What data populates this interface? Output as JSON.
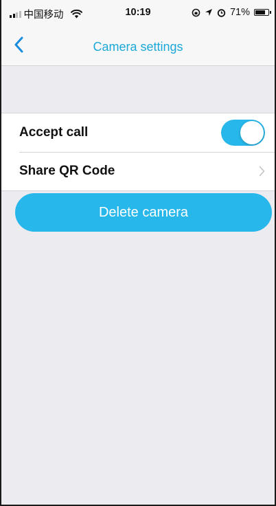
{
  "status_bar": {
    "carrier": "中国移动",
    "time": "10:19",
    "battery": "71%",
    "battery_level": 0.71
  },
  "nav": {
    "title": "Camera settings",
    "back_icon": "chevron-left-icon"
  },
  "settings": {
    "accept_call": {
      "label": "Accept call",
      "enabled": true
    },
    "share_qr": {
      "label": "Share QR Code"
    }
  },
  "actions": {
    "delete_label": "Delete camera"
  },
  "colors": {
    "accent": "#27b7ea",
    "title": "#1ba8d8",
    "background": "#ebebf0"
  }
}
